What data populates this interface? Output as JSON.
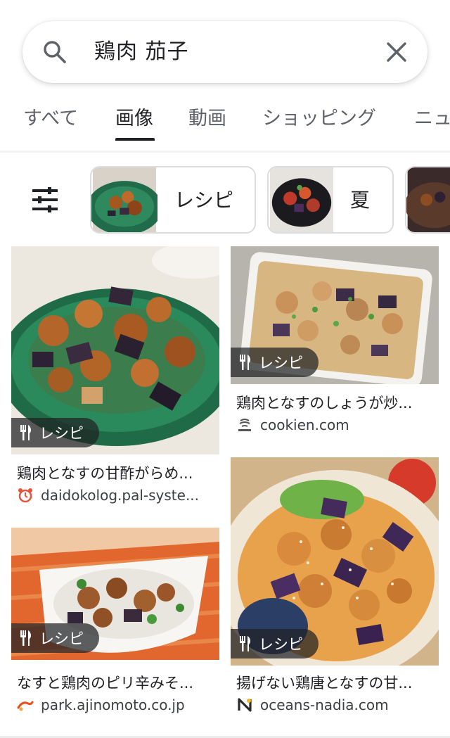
{
  "search": {
    "query": "鶏肉 茄子"
  },
  "tabs": [
    {
      "label": "すべて",
      "active": false
    },
    {
      "label": "画像",
      "active": true
    },
    {
      "label": "動画",
      "active": false
    },
    {
      "label": "ショッピング",
      "active": false
    },
    {
      "label": "ニュ",
      "active": false
    }
  ],
  "chips": [
    {
      "label": "レシピ"
    },
    {
      "label": "夏"
    }
  ],
  "results": [
    {
      "badge": "レシピ",
      "title": "鶏肉となすの甘酢がらめ...",
      "source": "daidokolog.pal-syste..."
    },
    {
      "badge": "レシピ",
      "title": "鶏肉となすのしょうが炒...",
      "source": "cookien.com"
    },
    {
      "badge": "レシピ",
      "title": "なすと鶏肉のピリ辛みそ...",
      "source": "park.ajinomoto.co.jp"
    },
    {
      "badge": "レシピ",
      "title": "揚げない鶏唐となすの甘...",
      "source": "oceans-nadia.com"
    }
  ],
  "colors": {
    "active_tab": "#202124",
    "inactive_tab": "#5f6368",
    "chip_border": "#dadce0",
    "badge_bg": "#202124"
  }
}
